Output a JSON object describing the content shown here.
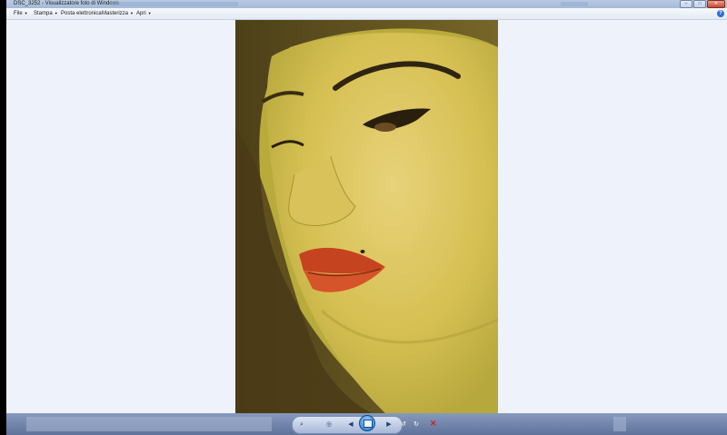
{
  "window": {
    "title": "DSC_3252 - Visualizzatore foto di Windows",
    "buttons": {
      "minimize": "–",
      "maximize": "□",
      "close": "✕"
    }
  },
  "menu": [
    {
      "label": "File"
    },
    {
      "label": "Stampa"
    },
    {
      "label": "Posta elettronica"
    },
    {
      "label": "Masterizza"
    },
    {
      "label": "Apri"
    }
  ],
  "help_label": "?",
  "photo": {
    "description_icon": "photo-image"
  },
  "toolbar": {
    "zoom": "⌕",
    "fit": "◎",
    "previous": "◀",
    "next": "▶",
    "rotate_left": "↺",
    "rotate_right": "↻",
    "delete": "✕"
  },
  "colors": {
    "accent": "#2a6fd1",
    "delete": "#c8261b",
    "photo_bg": "#c8bc3a"
  }
}
